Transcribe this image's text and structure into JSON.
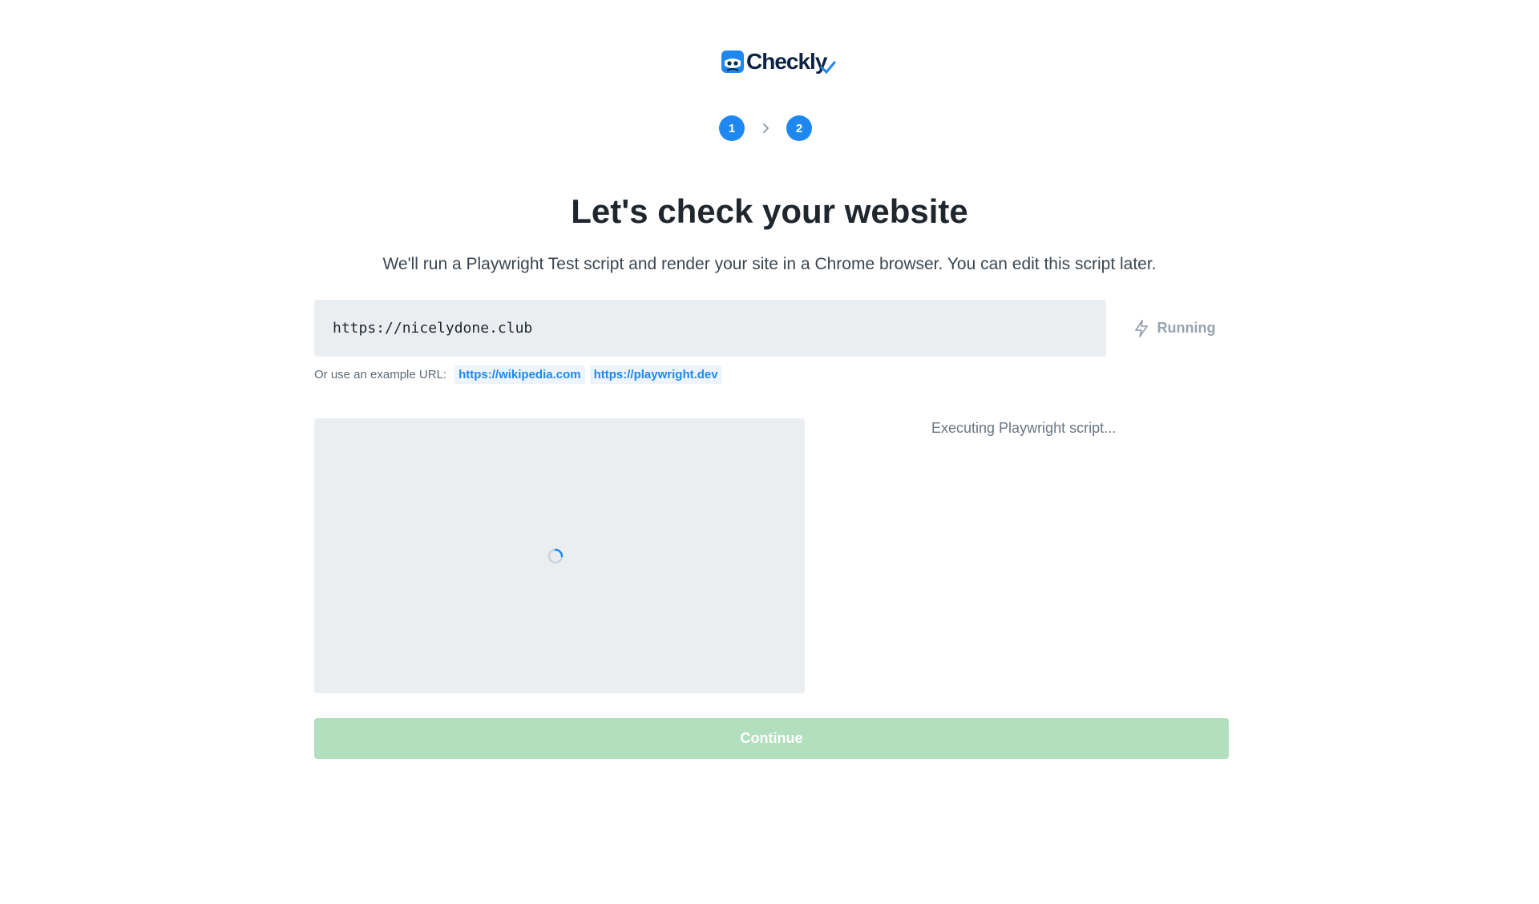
{
  "brand": {
    "name": "Checkly",
    "color": "#1e88f0",
    "text_color": "#0c2343"
  },
  "steps": [
    {
      "label": "1"
    },
    {
      "label": "2"
    }
  ],
  "header": {
    "title": "Let's check your website",
    "subtitle": "We'll run a Playwright Test script and render your site in a Chrome browser. You can edit this script later."
  },
  "url_input": {
    "value": "https://nicelydone.club"
  },
  "run_button": {
    "label": "Running",
    "icon": "lightning-icon"
  },
  "examples": {
    "label": "Or use an example URL:",
    "links": [
      {
        "label": "https://wikipedia.com"
      },
      {
        "label": "https://playwright.dev"
      }
    ]
  },
  "preview": {
    "state": "loading",
    "status": "Executing Playwright script..."
  },
  "continue_button": {
    "label": "Continue",
    "color": "#b2e0be"
  }
}
